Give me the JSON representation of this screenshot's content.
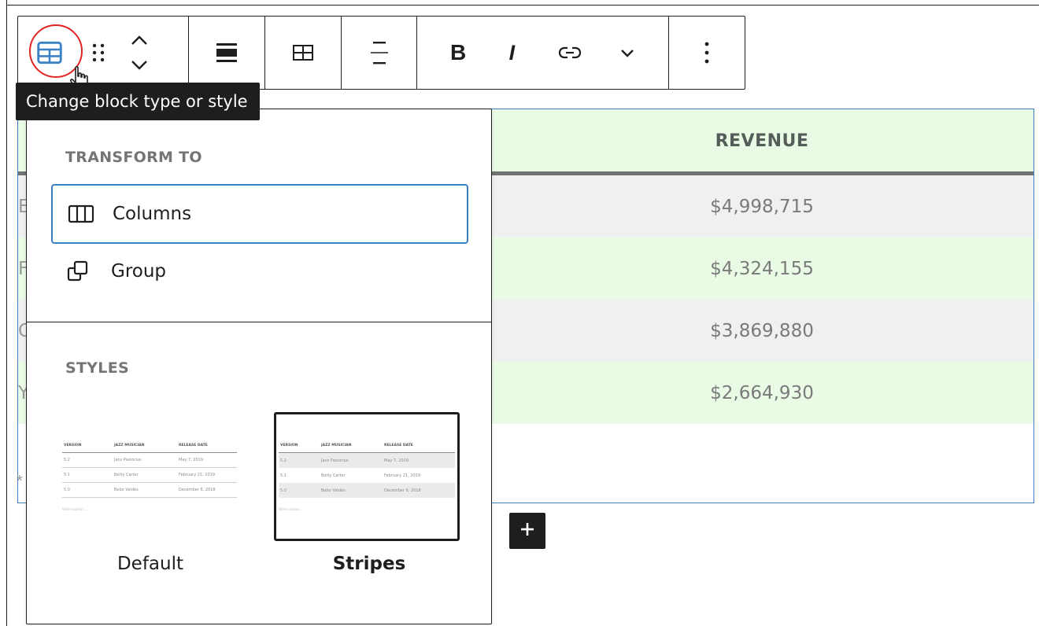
{
  "toolbar": {
    "tooltip": "Change block type or style",
    "buttons": [
      {
        "icon": "table-icon",
        "label": "Change block type or style"
      },
      {
        "icon": "drag-handle-icon"
      },
      {
        "icon": "move-up-icon"
      },
      {
        "icon": "move-down-icon"
      },
      {
        "icon": "align-icon"
      },
      {
        "icon": "edit-table-icon"
      },
      {
        "icon": "align-column-icon"
      },
      {
        "icon": "bold-icon",
        "label": "B"
      },
      {
        "icon": "italic-icon",
        "label": "I"
      },
      {
        "icon": "link-icon"
      },
      {
        "icon": "chevron-down-icon"
      },
      {
        "icon": "more-options-icon"
      }
    ],
    "bold_label": "B",
    "italic_label": "I"
  },
  "table": {
    "header": "REVENUE",
    "rows": [
      {
        "first_partial": "E",
        "revenue": "$4,998,715"
      },
      {
        "first_partial": "F",
        "revenue": "$4,324,155"
      },
      {
        "first_partial": "C",
        "revenue": "$3,869,880"
      },
      {
        "first_partial": "Y",
        "revenue": "$2,664,930"
      }
    ],
    "caption_partial": "*"
  },
  "popover": {
    "transform_title": "TRANSFORM TO",
    "transform_items": [
      {
        "label": "Columns",
        "icon": "columns-icon",
        "focused": true
      },
      {
        "label": "Group",
        "icon": "group-icon"
      }
    ],
    "styles_title": "STYLES",
    "styles": [
      {
        "label": "Default",
        "active": false
      },
      {
        "label": "Stripes",
        "active": true
      }
    ],
    "preview": {
      "headers": [
        "VERSION",
        "JAZZ MUSICIAN",
        "RELEASE DATE"
      ],
      "rows": [
        [
          "5.2",
          "Jaco Pastorius",
          "May 7, 2019"
        ],
        [
          "5.1",
          "Betty Carter",
          "February 21, 2019"
        ],
        [
          "5.0",
          "Bebo Valdés",
          "December 6, 2018"
        ]
      ],
      "caption": "Write caption…"
    }
  },
  "colors": {
    "accent_blue": "#3b82c4",
    "focus_ring_red": "#e02424",
    "header_green": "#e9fbe5",
    "stripe_gray": "#f0f0f0",
    "dark": "#1e1e1e"
  }
}
